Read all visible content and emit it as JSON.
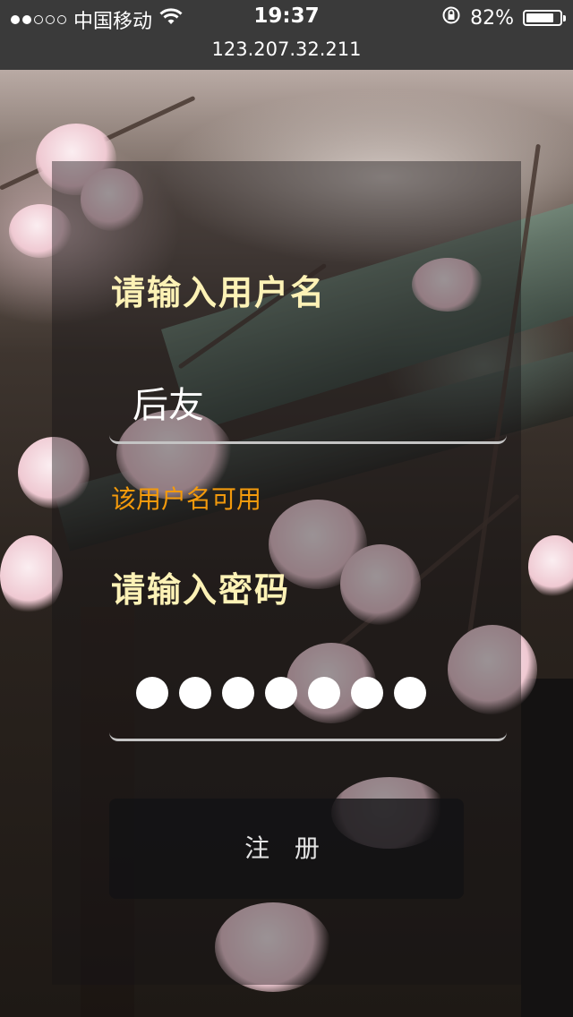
{
  "status_bar": {
    "carrier": "中国移动",
    "time": "19:37",
    "battery_percent": "82%",
    "battery_level": 0.82,
    "signal_filled": 2,
    "signal_total": 5,
    "wifi_icon": "wifi-icon",
    "rotation_lock_icon": "rotation-lock-icon"
  },
  "url_bar": {
    "address": "123.207.32.211"
  },
  "form": {
    "username_label": "请输入用户名",
    "username_value": "后友",
    "username_hint": "该用户名可用",
    "password_label": "请输入密码",
    "password_length": 7,
    "submit_label": "注 册"
  },
  "colors": {
    "label": "#fdf2b6",
    "hint": "#f39a0c",
    "status_bar": "#3a3a3a"
  }
}
